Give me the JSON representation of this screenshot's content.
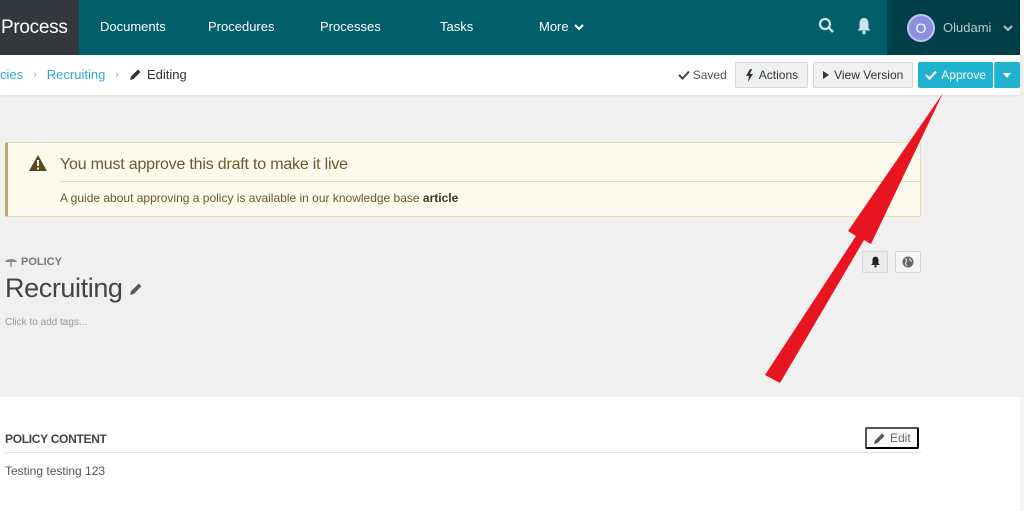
{
  "nav": {
    "brand": "Process",
    "items": [
      "Documents",
      "Procedures",
      "Processes",
      "Tasks"
    ],
    "more_label": "More",
    "user": {
      "initial": "O",
      "name": "Oludami"
    }
  },
  "breadcrumb": {
    "items": [
      "cies",
      "Recruiting"
    ],
    "current": "Editing"
  },
  "toolbar": {
    "saved_label": "Saved",
    "actions_label": "Actions",
    "view_version_label": "View Version",
    "approve_label": "Approve"
  },
  "alert": {
    "title": "You must approve this draft to make it live",
    "body_prefix": "A guide about approving a policy is available in our knowledge base ",
    "link_label": "article"
  },
  "document": {
    "type_label": "POLICY",
    "title": "Recruiting",
    "tags_placeholder": "Click to add tags..."
  },
  "content_section": {
    "title": "POLICY CONTENT",
    "edit_label": "Edit",
    "body": "Testing testing 123"
  },
  "colors": {
    "nav_bg": "#005f6b",
    "brand_bg": "#33383d",
    "user_bg": "#003f48",
    "approve": "#1fb3d1",
    "link": "#2eaad3",
    "alert_bg": "#fdfaee",
    "annotation_arrow": "#e8141f"
  }
}
